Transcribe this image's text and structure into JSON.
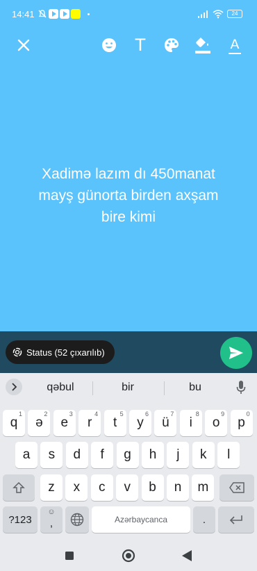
{
  "status_bar": {
    "time": "14:41",
    "battery": "24"
  },
  "editor": {
    "caption": "Xadimə lazım dı 450manat\nmayş günorta birden axşam\nbire kimi",
    "background_color": "#5bc3fb",
    "tools": [
      "close-icon",
      "emoji-icon",
      "text-icon",
      "palette-icon",
      "fill-color-icon",
      "text-color-icon"
    ],
    "text_tool_label": "T",
    "text_color_label": "A"
  },
  "audience": {
    "label": "Status (52 çıxarılıb)"
  },
  "keyboard": {
    "suggestions": [
      "qəbul",
      "bir",
      "bu"
    ],
    "row1": [
      {
        "k": "q",
        "h": "1"
      },
      {
        "k": "ə",
        "h": "2"
      },
      {
        "k": "e",
        "h": "3"
      },
      {
        "k": "r",
        "h": "4"
      },
      {
        "k": "t",
        "h": "5"
      },
      {
        "k": "y",
        "h": "6"
      },
      {
        "k": "ü",
        "h": "7"
      },
      {
        "k": "i",
        "h": "8"
      },
      {
        "k": "o",
        "h": "9"
      },
      {
        "k": "p",
        "h": "0"
      }
    ],
    "row2": [
      "a",
      "s",
      "d",
      "f",
      "g",
      "h",
      "j",
      "k",
      "l"
    ],
    "row3": [
      "z",
      "x",
      "c",
      "v",
      "b",
      "n",
      "m"
    ],
    "symbols_label": "?123",
    "comma_label": ",",
    "space_label": "Azərbaycanca",
    "period_label": "."
  }
}
